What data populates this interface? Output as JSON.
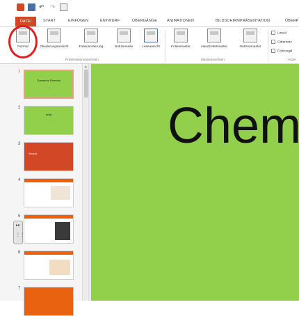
{
  "quick_access": {
    "app_icon": "powerpoint-icon",
    "save_icon": "save-icon",
    "undo_icon": "undo-icon",
    "redo_icon": "redo-icon",
    "present_icon": "start-presentation-icon"
  },
  "tabs": [
    {
      "label": "DATEI"
    },
    {
      "label": "START"
    },
    {
      "label": "EINFÜGEN"
    },
    {
      "label": "ENTWURF"
    },
    {
      "label": "ÜBERGÄNGE"
    },
    {
      "label": "ANIMATIONEN"
    },
    {
      "label": "BILDSCHIRMPRÄSENTATION"
    },
    {
      "label": "ÜBERP"
    }
  ],
  "ribbon": {
    "presentation_views": {
      "buttons": [
        {
          "label": "Normal",
          "icon": "normal-view-icon"
        },
        {
          "label": "Gliederungsansicht",
          "icon": "outline-view-icon"
        },
        {
          "label": "Foliensortierung",
          "icon": "slide-sorter-icon"
        },
        {
          "label": "Notizenseite",
          "icon": "notes-page-icon"
        },
        {
          "label": "Leseansicht",
          "icon": "reading-view-icon"
        }
      ],
      "group_label": "Präsentationsansichten"
    },
    "master_views": {
      "buttons": [
        {
          "label": "Folienmaster",
          "icon": "slide-master-icon"
        },
        {
          "label": "Handzettelmaster",
          "icon": "handout-master-icon"
        },
        {
          "label": "Notizenmaster",
          "icon": "notes-master-icon"
        }
      ],
      "group_label": "Masteransichten"
    },
    "show": {
      "checkboxes": [
        {
          "label": "Lineal",
          "checked": false
        },
        {
          "label": "Gitternetz",
          "checked": false
        },
        {
          "label": "Führungsl",
          "checked": false
        }
      ],
      "group_label": "Anzei"
    }
  },
  "slides": [
    {
      "number": "1",
      "title": "Chemische Elemente",
      "subtitle": "—",
      "bg": "#92cf4a",
      "selected": true
    },
    {
      "number": "2",
      "title": "Inhalt",
      "bg": "#92cf4a",
      "selected": false
    },
    {
      "number": "3",
      "title": "Vorwort",
      "bg": "#d24726",
      "selected": false
    },
    {
      "number": "4",
      "title": "",
      "bg": "#ffffff",
      "selected": false
    },
    {
      "number": "5",
      "title": "",
      "bg": "#ffffff",
      "selected": false
    },
    {
      "number": "6",
      "title": "",
      "bg": "#ffffff",
      "selected": false
    },
    {
      "number": "7",
      "title": "",
      "bg": "#e8620f",
      "selected": false
    }
  ],
  "main_slide": {
    "title": "Chem",
    "bg": "#92cf4a"
  },
  "colors": {
    "file_tab": "#d24726",
    "slide_green": "#92cf4a",
    "highlight_circle": "#e02020"
  }
}
